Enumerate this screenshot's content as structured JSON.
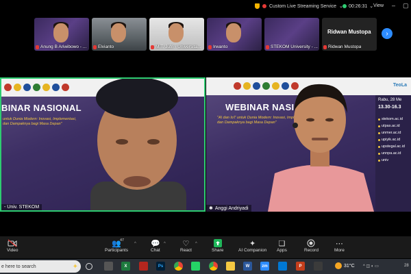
{
  "status_bar": {
    "stream_label": "Custom Live Streaming Service",
    "stream_caret": "⌄",
    "timer": "00:26:31",
    "timer_caret": "⌄",
    "view_label": "View",
    "minimize": "–",
    "maximize": "▢"
  },
  "thumbnails": [
    {
      "name": "Anung B Ariwibowo - ...",
      "style": "slide",
      "muted": true
    },
    {
      "name": "Elvianto",
      "style": "room",
      "muted": true
    },
    {
      "name": "M.T. Jufri - Universita...",
      "style": "white",
      "muted": true
    },
    {
      "name": "Irwanto",
      "style": "slide",
      "muted": true
    },
    {
      "name": "STEKOM University - ...",
      "style": "slide",
      "muted": true
    },
    {
      "name": "Ridwan Mustopa",
      "big_name": "Ridwan Mustopa",
      "style": "plain",
      "muted": true
    }
  ],
  "next_page_icon": "›",
  "tiles": {
    "left": {
      "slide_title": "BINAR NASIONAL",
      "slide_subtitle_1": "untuk Dunia Modern: Inovasi, Implementasi,",
      "slide_subtitle_2": "dan Dampaknya bagi Masa Depan\"",
      "name_label": "- Univ. STEKOM",
      "active_speaker_color": "#2ecc71"
    },
    "right": {
      "slide_title": "WEBINAR NASIONAL",
      "slide_subtitle_1": "\"AI dan IoT untuk Dunia Modern: Inovasi, Implementasi,",
      "slide_subtitle_2": "dan Dampaknya bagi Masa Depan\"",
      "schedule_date": "Rabu, 28 Me",
      "schedule_time": "13.30-16.3",
      "sites": [
        "stekom.ac.id",
        "utpas.ac.id",
        "unmer.ac.id",
        "upiyik.ac.id",
        "upstegal.ac.id",
        "unnpa.ac.id",
        "univ"
      ],
      "name_label": "Anggi Andriyadi",
      "badge_text": "TeoLa"
    }
  },
  "toolbar": {
    "video": "Video",
    "participants": "Participants",
    "participants_count": "47",
    "chat": "Chat",
    "react": "React",
    "share": "Share",
    "ai_companion": "AI Companion",
    "apps": "Apps",
    "record": "Record",
    "more": "More"
  },
  "taskbar": {
    "search_text": "e here to search",
    "temperature": "31°C",
    "tray_text": "28"
  },
  "colors": {
    "share_green": "#1fb75a",
    "zoom_blue": "#2d8cff",
    "muted_red": "#e53935"
  }
}
